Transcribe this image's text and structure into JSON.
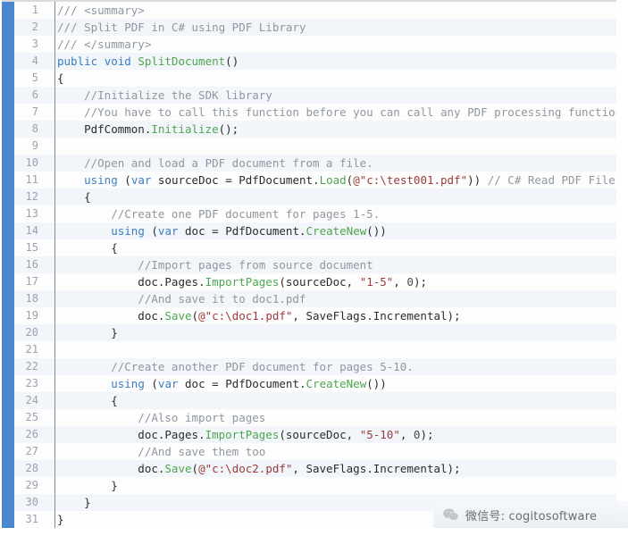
{
  "editor": {
    "language": "csharp",
    "accent_color": "#4a87cd",
    "gutter_color": "#9aa3ad",
    "stripe_odd_color": "#fdfdfe",
    "stripe_even_color": "#f2f6fa",
    "first_line_number": 1,
    "last_line_number": 31,
    "colors": {
      "comment": "#8e979f",
      "keyword": "#3a7fc1",
      "type": "#4ea64e",
      "method": "#4ea64e",
      "string": "#9b3a3a",
      "number": "#4a4a4a",
      "plain": "#2b2b2b"
    },
    "lines": [
      {
        "n": "1",
        "tokens": [
          {
            "t": "cmt",
            "s": "/// <summary>"
          }
        ]
      },
      {
        "n": "2",
        "tokens": [
          {
            "t": "cmt",
            "s": "/// Split PDF in C# using PDF Library"
          }
        ]
      },
      {
        "n": "3",
        "tokens": [
          {
            "t": "cmt",
            "s": "/// </summary>"
          }
        ]
      },
      {
        "n": "4",
        "tokens": [
          {
            "t": "kw",
            "s": "public"
          },
          {
            "t": "pln",
            "s": " "
          },
          {
            "t": "kw",
            "s": "void"
          },
          {
            "t": "pln",
            "s": " "
          },
          {
            "t": "mth",
            "s": "SplitDocument"
          },
          {
            "t": "pun",
            "s": "()"
          }
        ]
      },
      {
        "n": "5",
        "tokens": [
          {
            "t": "pun",
            "s": "{"
          }
        ]
      },
      {
        "n": "6",
        "tokens": [
          {
            "t": "cmt",
            "s": "    //Initialize the SDK library"
          }
        ]
      },
      {
        "n": "7",
        "tokens": [
          {
            "t": "cmt",
            "s": "    //You have to call this function before you can call any PDF processing functions."
          }
        ]
      },
      {
        "n": "8",
        "tokens": [
          {
            "t": "pln",
            "s": "    PdfCommon."
          },
          {
            "t": "mth",
            "s": "Initialize"
          },
          {
            "t": "pun",
            "s": "();"
          }
        ]
      },
      {
        "n": "9",
        "tokens": [
          {
            "t": "pln",
            "s": ""
          }
        ]
      },
      {
        "n": "10",
        "tokens": [
          {
            "t": "cmt",
            "s": "    //Open and load a PDF document from a file."
          }
        ]
      },
      {
        "n": "11",
        "tokens": [
          {
            "t": "pln",
            "s": "    "
          },
          {
            "t": "kw",
            "s": "using"
          },
          {
            "t": "pun",
            "s": " ("
          },
          {
            "t": "kw",
            "s": "var"
          },
          {
            "t": "pln",
            "s": " sourceDoc "
          },
          {
            "t": "pun",
            "s": "= "
          },
          {
            "t": "pln",
            "s": "PdfDocument."
          },
          {
            "t": "mth",
            "s": "Load"
          },
          {
            "t": "pun",
            "s": "("
          },
          {
            "t": "str",
            "s": "@\"c:\\test001.pdf\""
          },
          {
            "t": "pun",
            "s": ")) "
          },
          {
            "t": "cmt",
            "s": "// C# Read PDF File"
          }
        ]
      },
      {
        "n": "12",
        "tokens": [
          {
            "t": "pun",
            "s": "    {"
          }
        ]
      },
      {
        "n": "13",
        "tokens": [
          {
            "t": "cmt",
            "s": "        //Create one PDF document for pages 1-5."
          }
        ]
      },
      {
        "n": "14",
        "tokens": [
          {
            "t": "pln",
            "s": "        "
          },
          {
            "t": "kw",
            "s": "using"
          },
          {
            "t": "pun",
            "s": " ("
          },
          {
            "t": "kw",
            "s": "var"
          },
          {
            "t": "pln",
            "s": " doc "
          },
          {
            "t": "pun",
            "s": "= "
          },
          {
            "t": "pln",
            "s": "PdfDocument."
          },
          {
            "t": "mth",
            "s": "CreateNew"
          },
          {
            "t": "pun",
            "s": "())"
          }
        ]
      },
      {
        "n": "15",
        "tokens": [
          {
            "t": "pun",
            "s": "        {"
          }
        ]
      },
      {
        "n": "16",
        "tokens": [
          {
            "t": "cmt",
            "s": "            //Import pages from source document"
          }
        ]
      },
      {
        "n": "17",
        "tokens": [
          {
            "t": "pln",
            "s": "            doc.Pages."
          },
          {
            "t": "mth",
            "s": "ImportPages"
          },
          {
            "t": "pun",
            "s": "("
          },
          {
            "t": "pln",
            "s": "sourceDoc"
          },
          {
            "t": "pun",
            "s": ", "
          },
          {
            "t": "str",
            "s": "\"1-5\""
          },
          {
            "t": "pun",
            "s": ", "
          },
          {
            "t": "num",
            "s": "0"
          },
          {
            "t": "pun",
            "s": ");"
          }
        ]
      },
      {
        "n": "18",
        "tokens": [
          {
            "t": "cmt",
            "s": "            //And save it to doc1.pdf"
          }
        ]
      },
      {
        "n": "19",
        "tokens": [
          {
            "t": "pln",
            "s": "            doc."
          },
          {
            "t": "mth",
            "s": "Save"
          },
          {
            "t": "pun",
            "s": "("
          },
          {
            "t": "str",
            "s": "@\"c:\\doc1.pdf\""
          },
          {
            "t": "pun",
            "s": ", "
          },
          {
            "t": "pln",
            "s": "SaveFlags.Incremental"
          },
          {
            "t": "pun",
            "s": ");"
          }
        ]
      },
      {
        "n": "20",
        "tokens": [
          {
            "t": "pun",
            "s": "        }"
          }
        ]
      },
      {
        "n": "21",
        "tokens": [
          {
            "t": "pln",
            "s": ""
          }
        ]
      },
      {
        "n": "22",
        "tokens": [
          {
            "t": "cmt",
            "s": "        //Create another PDF document for pages 5-10."
          }
        ]
      },
      {
        "n": "23",
        "tokens": [
          {
            "t": "pln",
            "s": "        "
          },
          {
            "t": "kw",
            "s": "using"
          },
          {
            "t": "pun",
            "s": " ("
          },
          {
            "t": "kw",
            "s": "var"
          },
          {
            "t": "pln",
            "s": " doc "
          },
          {
            "t": "pun",
            "s": "= "
          },
          {
            "t": "pln",
            "s": "PdfDocument."
          },
          {
            "t": "mth",
            "s": "CreateNew"
          },
          {
            "t": "pun",
            "s": "())"
          }
        ]
      },
      {
        "n": "24",
        "tokens": [
          {
            "t": "pun",
            "s": "        {"
          }
        ]
      },
      {
        "n": "25",
        "tokens": [
          {
            "t": "cmt",
            "s": "            //Also import pages"
          }
        ]
      },
      {
        "n": "26",
        "tokens": [
          {
            "t": "pln",
            "s": "            doc.Pages."
          },
          {
            "t": "mth",
            "s": "ImportPages"
          },
          {
            "t": "pun",
            "s": "("
          },
          {
            "t": "pln",
            "s": "sourceDoc"
          },
          {
            "t": "pun",
            "s": ", "
          },
          {
            "t": "str",
            "s": "\"5-10\""
          },
          {
            "t": "pun",
            "s": ", "
          },
          {
            "t": "num",
            "s": "0"
          },
          {
            "t": "pun",
            "s": ");"
          }
        ]
      },
      {
        "n": "27",
        "tokens": [
          {
            "t": "cmt",
            "s": "            //And save them too"
          }
        ]
      },
      {
        "n": "28",
        "tokens": [
          {
            "t": "pln",
            "s": "            doc."
          },
          {
            "t": "mth",
            "s": "Save"
          },
          {
            "t": "pun",
            "s": "("
          },
          {
            "t": "str",
            "s": "@\"c:\\doc2.pdf\""
          },
          {
            "t": "pun",
            "s": ", "
          },
          {
            "t": "pln",
            "s": "SaveFlags.Incremental"
          },
          {
            "t": "pun",
            "s": ");"
          }
        ]
      },
      {
        "n": "29",
        "tokens": [
          {
            "t": "pun",
            "s": "        }"
          }
        ]
      },
      {
        "n": "30",
        "tokens": [
          {
            "t": "pun",
            "s": "    }"
          }
        ]
      },
      {
        "n": "31",
        "tokens": [
          {
            "t": "pun",
            "s": "}"
          }
        ]
      }
    ]
  },
  "watermark": {
    "icon": "wechat-icon",
    "text": "微信号: cogitosoftware"
  }
}
